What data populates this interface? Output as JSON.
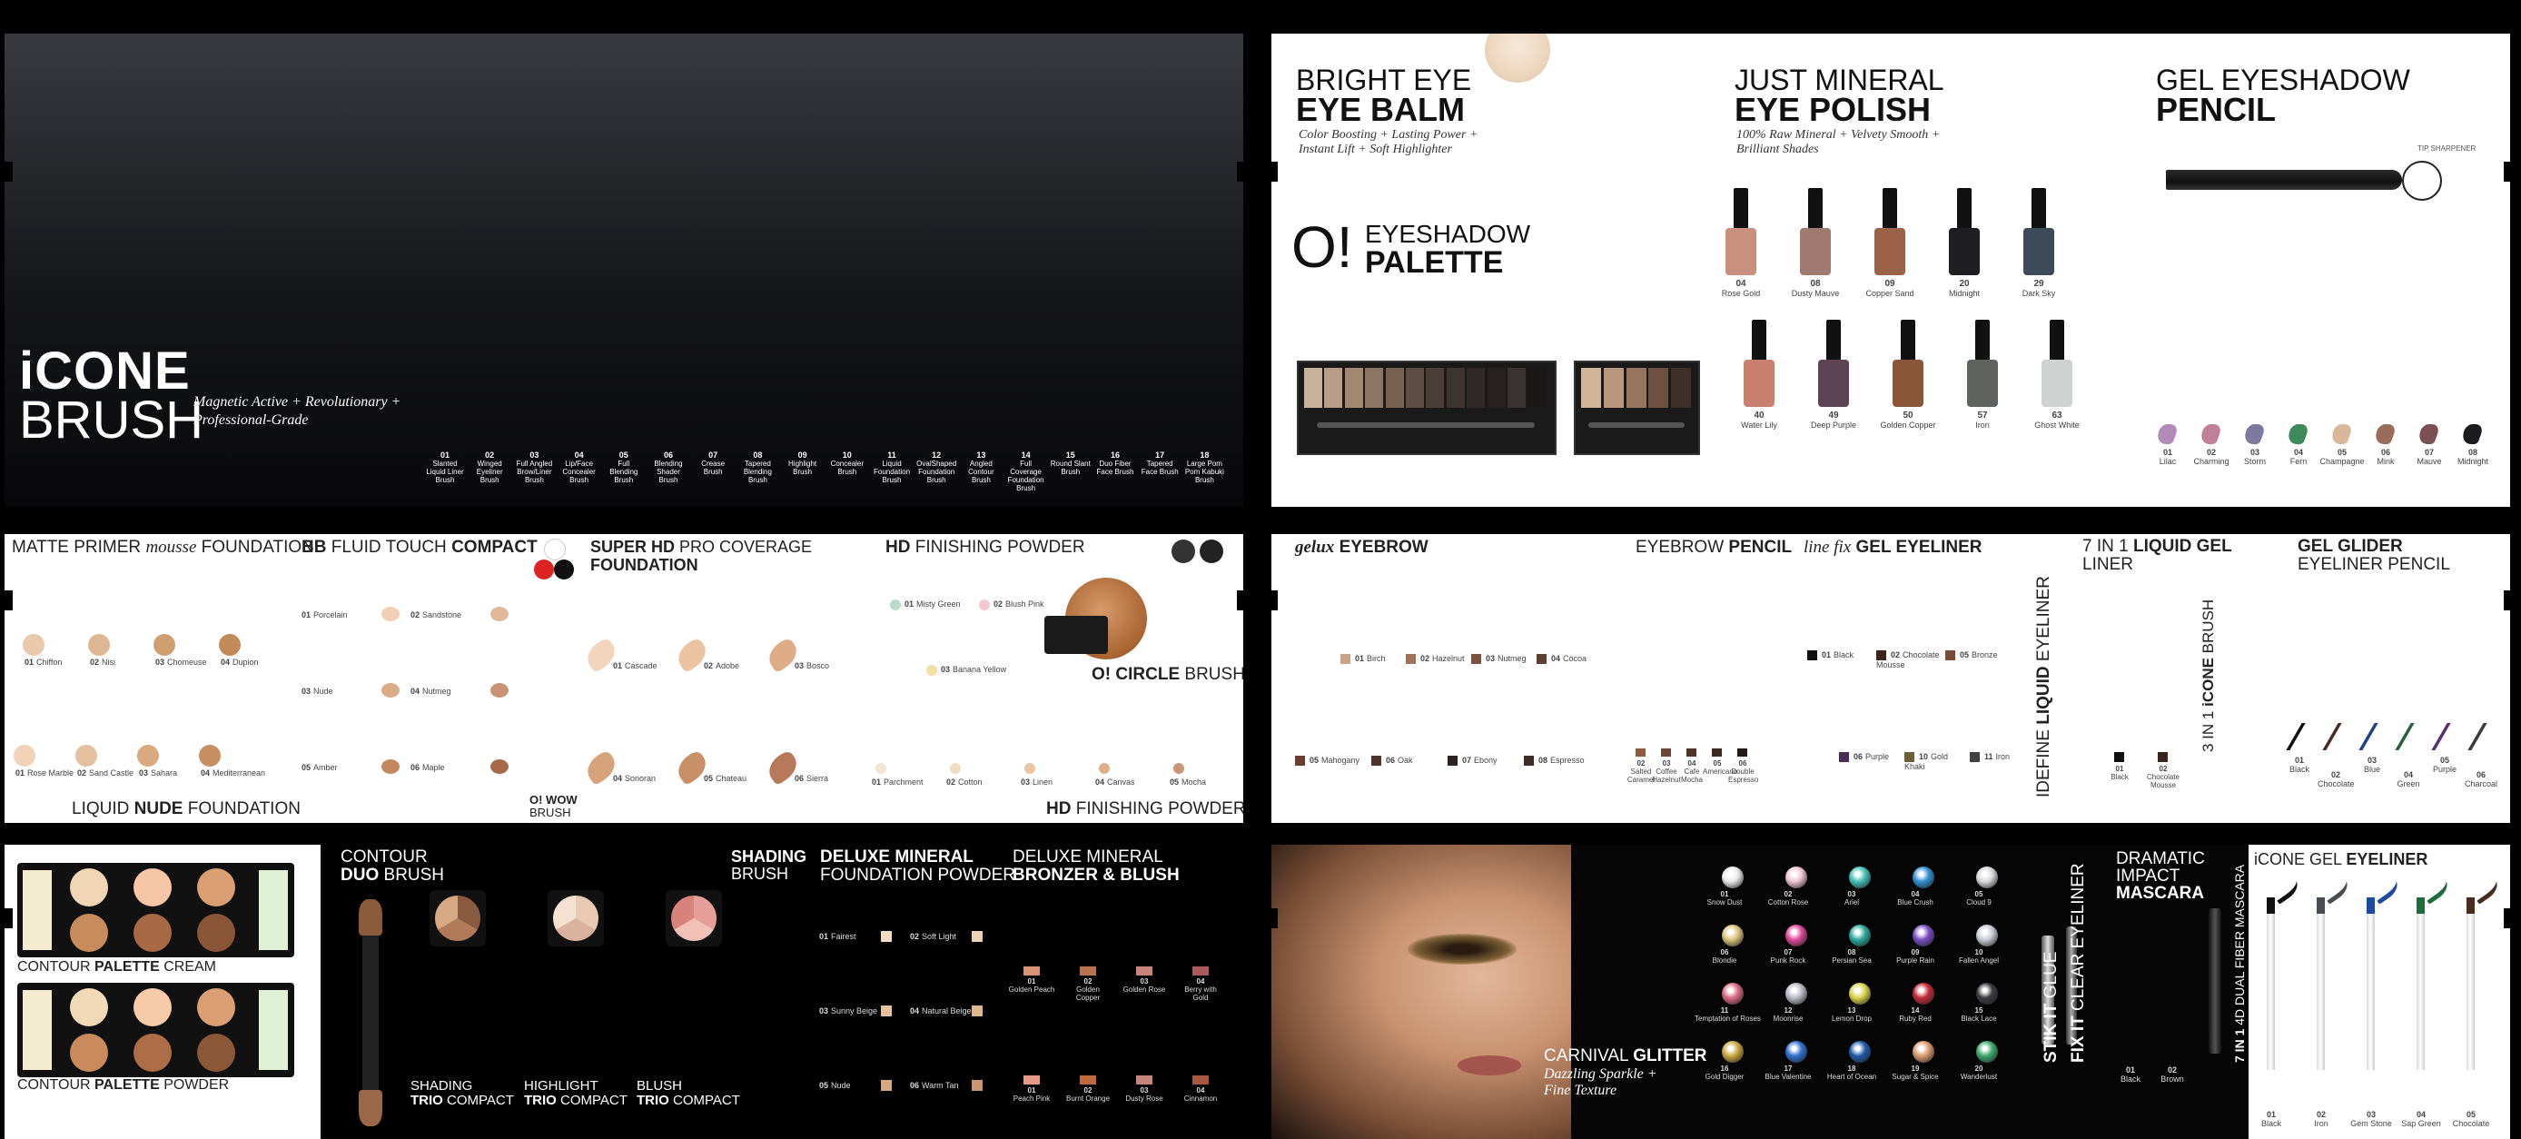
{
  "panel1": {
    "brand_line1": "iCONE",
    "brand_line2": "BRUSH",
    "tagline1": "Magnetic Active + Revolutionary +",
    "tagline2": "Professional-Grade",
    "brushes": [
      {
        "num": "01",
        "name": "Slanted Liquid Liner Brush"
      },
      {
        "num": "02",
        "name": "Winged Eyeliner Brush"
      },
      {
        "num": "03",
        "name": "Full Angled Brow/Liner Brush"
      },
      {
        "num": "04",
        "name": "Lip/Face Concealer Brush"
      },
      {
        "num": "05",
        "name": "Full Blending Brush"
      },
      {
        "num": "06",
        "name": "Blending Shader Brush"
      },
      {
        "num": "07",
        "name": "Crease Brush"
      },
      {
        "num": "08",
        "name": "Tapered Blending Brush"
      },
      {
        "num": "09",
        "name": "Highlight Brush"
      },
      {
        "num": "10",
        "name": "Concealer Brush"
      },
      {
        "num": "11",
        "name": "Liquid Foundation Brush"
      },
      {
        "num": "12",
        "name": "OvalShaped Foundation Brush"
      },
      {
        "num": "13",
        "name": "Angled Contour Brush"
      },
      {
        "num": "14",
        "name": "Full Coverage Foundation Brush"
      },
      {
        "num": "15",
        "name": "Round Slant Brush"
      },
      {
        "num": "16",
        "name": "Duo Fiber Face Brush"
      },
      {
        "num": "17",
        "name": "Tapered Face Brush"
      },
      {
        "num": "18",
        "name": "Large Pom Pom Kabuki Brush"
      }
    ]
  },
  "panel2": {
    "balm_l1": "BRIGHT EYE",
    "balm_l2": "EYE BALM",
    "balm_sub1": "Color Boosting + Lasting Power +",
    "balm_sub2": "Instant Lift + Soft Highlighter",
    "palette_o": "O!",
    "palette_l1": "EYESHADOW",
    "palette_l2": "PALETTE",
    "mineral_l1": "JUST MINERAL",
    "mineral_l2": "EYE POLISH",
    "mineral_sub1": "100% Raw Mineral + Velvety Smooth +",
    "mineral_sub2": "Brilliant Shades",
    "gel_l1": "GEL EYESHADOW",
    "gel_l2": "PENCIL",
    "tip": "TIP SHARPENER",
    "polish_top": [
      {
        "num": "04",
        "name": "Rose Gold",
        "color": "#c98f7f"
      },
      {
        "num": "08",
        "name": "Dusty Mauve",
        "color": "#a07a70"
      },
      {
        "num": "09",
        "name": "Copper Sand",
        "color": "#9c6248"
      },
      {
        "num": "20",
        "name": "Midnight",
        "color": "#1d1d22"
      },
      {
        "num": "29",
        "name": "Dark Sky",
        "color": "#3d4a57"
      }
    ],
    "polish_bottom": [
      {
        "num": "40",
        "name": "Water Lily",
        "color": "#c9806e"
      },
      {
        "num": "49",
        "name": "Deep Purple",
        "color": "#5c4452"
      },
      {
        "num": "50",
        "name": "Golden Copper",
        "color": "#8b5638"
      },
      {
        "num": "57",
        "name": "Iron",
        "color": "#5f6360"
      },
      {
        "num": "63",
        "name": "Ghost White",
        "color": "#cfd2d1"
      }
    ],
    "pencils": [
      {
        "num": "01",
        "name": "Lilac",
        "color": "#b48ab8"
      },
      {
        "num": "02",
        "name": "Charming",
        "color": "#c17f98"
      },
      {
        "num": "03",
        "name": "Storm",
        "color": "#7d7aa0"
      },
      {
        "num": "04",
        "name": "Fern",
        "color": "#3f8a5b"
      },
      {
        "num": "05",
        "name": "Champagne",
        "color": "#d9b79b"
      },
      {
        "num": "06",
        "name": "Mink",
        "color": "#9a6c5a"
      },
      {
        "num": "07",
        "name": "Mauve",
        "color": "#7c4f52"
      },
      {
        "num": "08",
        "name": "Midnight",
        "color": "#1a1a1f"
      }
    ]
  },
  "panel3": {
    "matte_a": "MATTE PRIMER",
    "matte_b": "mousse",
    "matte_c": "FOUNDATION",
    "bb_a": "BB",
    "bb_b": "FLUID TOUCH",
    "bb_c": "COMPACT",
    "shd_a": "SUPER HD",
    "shd_b": "PRO COVERAGE",
    "shd_c": "FOUNDATION",
    "hdp_a": "HD",
    "hdp_b": "FINISHING POWDER",
    "ocircle_a": "O!",
    "ocircle_b": "CIRCLE",
    "ocircle_c": "BRUSH",
    "liquid_a": "LIQUID",
    "liquid_b": "NUDE",
    "liquid_c": "FOUNDATION",
    "owow_a": "O! WOW",
    "owow_b": "BRUSH",
    "hdp2_a": "HD",
    "hdp2_b": "FINISHING POWDER",
    "matte_shades": [
      {
        "num": "01",
        "name": "Chiffon",
        "color": "#e8c9ab"
      },
      {
        "num": "02",
        "name": "Nisi",
        "color": "#ddb893"
      },
      {
        "num": "03",
        "name": "Chomeuse",
        "color": "#cf9f72"
      },
      {
        "num": "04",
        "name": "Dupion",
        "color": "#c18a58"
      }
    ],
    "liquid_shades": [
      {
        "num": "01",
        "name": "Rose Marble",
        "color": "#f0d3b9"
      },
      {
        "num": "02",
        "name": "Sand Castle",
        "color": "#e4c19e"
      },
      {
        "num": "03",
        "name": "Sahara",
        "color": "#d9a97f"
      },
      {
        "num": "04",
        "name": "Mediterranean",
        "color": "#c88f63"
      }
    ],
    "bb_shades": [
      {
        "num": "01",
        "name": "Porcelain",
        "color": "#f0cfb5"
      },
      {
        "num": "02",
        "name": "Sandstone",
        "color": "#e2b896"
      },
      {
        "num": "03",
        "name": "Nude",
        "color": "#d9ab88"
      },
      {
        "num": "04",
        "name": "Nutmeg",
        "color": "#c99473"
      },
      {
        "num": "05",
        "name": "Amber",
        "color": "#c4875e"
      },
      {
        "num": "06",
        "name": "Maple",
        "color": "#a96846"
      }
    ],
    "shd_shades": [
      {
        "num": "01",
        "name": "Cascade",
        "color": "#f3d5bd"
      },
      {
        "num": "02",
        "name": "Adobe",
        "color": "#ecc4a2"
      },
      {
        "num": "03",
        "name": "Bosco",
        "color": "#deac86"
      },
      {
        "num": "04",
        "name": "Sonoran",
        "color": "#d7a37b"
      },
      {
        "num": "05",
        "name": "Chateau",
        "color": "#c99068"
      },
      {
        "num": "06",
        "name": "Sierra",
        "color": "#b8795a"
      }
    ],
    "hdp_top": [
      {
        "num": "01",
        "name": "Misty Green",
        "color": "#b9dcc9"
      },
      {
        "num": "02",
        "name": "Blush Pink",
        "color": "#f3c8d0"
      },
      {
        "num": "03",
        "name": "Banana Yellow",
        "color": "#f3dfa6"
      }
    ],
    "hdp_bottom": [
      {
        "num": "01",
        "name": "Parchment",
        "color": "#f3e6d2"
      },
      {
        "num": "02",
        "name": "Cotton",
        "color": "#f2dcc0"
      },
      {
        "num": "03",
        "name": "Linen",
        "color": "#e9c7a2"
      },
      {
        "num": "04",
        "name": "Canvas",
        "color": "#dcb18a"
      },
      {
        "num": "05",
        "name": "Mocha",
        "color": "#c89672"
      }
    ]
  },
  "panel4": {
    "gelux_a": "gelux",
    "gelux_b": "EYEBROW",
    "pencil_a": "EYEBROW",
    "pencil_b": "PENCIL",
    "linefix_a": "line fix",
    "linefix_b": "GEL EYELINER",
    "idefine_a": "IDEFINE",
    "idefine_b": "LIQUID",
    "idefine_c": "EYELINER",
    "seven_a": "7 IN 1",
    "seven_b": "LIQUID GEL",
    "seven_c": "LINER",
    "icone_a": "3 IN 1",
    "icone_b": "iCONE",
    "icone_c": "BRUSH",
    "glider_a": "GEL GLIDER",
    "glider_b": "EYELINER PENCIL",
    "gelux_top": [
      {
        "num": "01",
        "name": "Birch",
        "color": "#c9a288"
      },
      {
        "num": "02",
        "name": "Hazelnut",
        "color": "#9f7257"
      },
      {
        "num": "03",
        "name": "Nutmeg",
        "color": "#7a5240"
      },
      {
        "num": "04",
        "name": "Cocoa",
        "color": "#5c3e33"
      }
    ],
    "gelux_bottom": [
      {
        "num": "05",
        "name": "Mahogany",
        "color": "#6b3d2f"
      },
      {
        "num": "06",
        "name": "Oak",
        "color": "#4e3329"
      },
      {
        "num": "07",
        "name": "Ebony",
        "color": "#2c221f"
      },
      {
        "num": "08",
        "name": "Espresso",
        "color": "#3c2a24"
      }
    ],
    "pencil_shades": [
      {
        "num": "02",
        "name": "Salted Caramel",
        "color": "#8d5b3d"
      },
      {
        "num": "03",
        "name": "Coffee Hazelnut",
        "color": "#6e4432"
      },
      {
        "num": "04",
        "name": "Cafe Mocha",
        "color": "#4f3428"
      },
      {
        "num": "05",
        "name": "Americano",
        "color": "#3c2a22"
      },
      {
        "num": "06",
        "name": "Double Espresso",
        "color": "#241a16"
      }
    ],
    "linefix_top": [
      {
        "num": "01",
        "name": "Black",
        "color": "#111111"
      },
      {
        "num": "02",
        "name": "Chocolate Mousse",
        "color": "#3a241b"
      },
      {
        "num": "05",
        "name": "Bronze",
        "color": "#7a4c35"
      }
    ],
    "linefix_bottom": [
      {
        "num": "06",
        "name": "Purple",
        "color": "#4a2d55"
      },
      {
        "num": "10",
        "name": "Gold Khaki",
        "color": "#6b6134"
      },
      {
        "num": "11",
        "name": "Iron",
        "color": "#3f4146"
      }
    ],
    "seven_shades": [
      {
        "num": "01",
        "name": "Black",
        "color": "#111111"
      },
      {
        "num": "02",
        "name": "Chocolate Mousse",
        "color": "#3a241b"
      }
    ],
    "glider_shades": [
      {
        "num": "01",
        "name": "Black",
        "color": "#111111"
      },
      {
        "num": "02",
        "name": "Chocolate",
        "color": "#4a2b1f"
      },
      {
        "num": "03",
        "name": "Blue",
        "color": "#1f3f8a"
      },
      {
        "num": "04",
        "name": "Green",
        "color": "#25603f"
      },
      {
        "num": "05",
        "name": "Purple",
        "color": "#5a2f6d"
      },
      {
        "num": "06",
        "name": "Charcoal",
        "color": "#3a3a3a"
      }
    ]
  },
  "panel5": {
    "contour_cream_a": "CONTOUR",
    "contour_cream_b": "PALETTE",
    "contour_cream_c": "CREAM",
    "contour_powder_a": "CONTOUR",
    "contour_powder_b": "PALETTE",
    "contour_powder_c": "POWDER",
    "duo_a": "CONTOUR",
    "duo_b": "DUO",
    "duo_c": "BRUSH",
    "shading_a": "SHADING",
    "shading_b": "BRUSH",
    "trio1_a": "SHADING",
    "trio1_b": "TRIO",
    "trio1_c": "COMPACT",
    "trio2_a": "HIGHLIGHT",
    "trio2_b": "TRIO",
    "trio2_c": "COMPACT",
    "trio3_a": "BLUSH",
    "trio3_b": "TRIO",
    "trio3_c": "COMPACT",
    "deluxe1_a": "DELUXE",
    "deluxe1_b": "MINERAL",
    "deluxe1_c": "FOUNDATION POWDER",
    "deluxe2_a": "DELUXE MINERAL",
    "deluxe2_b": "BRONZER & BLUSH",
    "foundation": [
      {
        "num": "01",
        "name": "Fairest",
        "color": "#f3dcc5"
      },
      {
        "num": "02",
        "name": "Soft Light",
        "color": "#efd2b6"
      },
      {
        "num": "03",
        "name": "Sunny Beige",
        "color": "#e6c29f"
      },
      {
        "num": "04",
        "name": "Natural Beige",
        "color": "#deb58f"
      },
      {
        "num": "05",
        "name": "Nude",
        "color": "#d6a882"
      },
      {
        "num": "06",
        "name": "Warm Tan",
        "color": "#c99672"
      }
    ],
    "bronzer_top": [
      {
        "num": "01",
        "name": "Golden Peach",
        "color": "#d89274"
      },
      {
        "num": "02",
        "name": "Golden Copper",
        "color": "#b8734f"
      },
      {
        "num": "03",
        "name": "Golden Rose",
        "color": "#c9847a"
      },
      {
        "num": "04",
        "name": "Berry with Gold",
        "color": "#a85a5d"
      }
    ],
    "bronzer_bottom": [
      {
        "num": "01",
        "name": "Peach Pink",
        "color": "#e79a8a"
      },
      {
        "num": "02",
        "name": "Burnt Orange",
        "color": "#c0683e"
      },
      {
        "num": "03",
        "name": "Dusty Rose",
        "color": "#c68579"
      },
      {
        "num": "04",
        "name": "Cinnamon",
        "color": "#a7583e"
      }
    ]
  },
  "panel6": {
    "carnival_a": "CARNIVAL",
    "carnival_b": "GLITTER",
    "carnival_sub1": "Dazzling Sparkle +",
    "carnival_sub2": "Fine Texture",
    "stikit_a": "STIK IT",
    "stikit_b": "GLUE",
    "fixit_a": "FIX IT",
    "fixit_b": "CLEAR EYELINER",
    "mascara_a": "DRAMATIC",
    "mascara_b": "IMPACT",
    "mascara_c": "MASCARA",
    "seven_mascara_a": "7 IN 1",
    "seven_mascara_b": "4D DUAL FIBER MASCARA",
    "icone_gel_a": "iCONE GEL",
    "icone_gel_b": "EYELINER",
    "glitter": [
      {
        "num": "01",
        "name": "Snow Dust",
        "color": "#e9e9ea"
      },
      {
        "num": "02",
        "name": "Cotton Rose",
        "color": "#f0c3d2"
      },
      {
        "num": "03",
        "name": "Ariel",
        "color": "#41c0b4"
      },
      {
        "num": "04",
        "name": "Blue Crush",
        "color": "#2f8fd0"
      },
      {
        "num": "05",
        "name": "Cloud 9",
        "color": "#d7d7dc"
      },
      {
        "num": "06",
        "name": "Blondie",
        "color": "#d9c37a"
      },
      {
        "num": "07",
        "name": "Punk Rock",
        "color": "#e0479a"
      },
      {
        "num": "08",
        "name": "Persian Sea",
        "color": "#2aa79a"
      },
      {
        "num": "09",
        "name": "Purple Rain",
        "color": "#7a4cc2"
      },
      {
        "num": "10",
        "name": "Fallen Angel",
        "color": "#c8cbd2"
      },
      {
        "num": "11",
        "name": "Temptation of Roses",
        "color": "#d86a82"
      },
      {
        "num": "12",
        "name": "Moonrise",
        "color": "#b9b9c5"
      },
      {
        "num": "13",
        "name": "Lemon Drop",
        "color": "#d8d24a"
      },
      {
        "num": "14",
        "name": "Ruby Red",
        "color": "#c42a36"
      },
      {
        "num": "15",
        "name": "Black Lace",
        "color": "#3a3a40"
      },
      {
        "num": "16",
        "name": "Gold Digger",
        "color": "#c9a53c"
      },
      {
        "num": "17",
        "name": "Blue Valentine",
        "color": "#2f6fd0"
      },
      {
        "num": "18",
        "name": "Heart of Ocean",
        "color": "#1f5aa8"
      },
      {
        "num": "19",
        "name": "Sugar & Spice",
        "color": "#d89a6e"
      },
      {
        "num": "20",
        "name": "Wanderlust",
        "color": "#3aa86a"
      }
    ],
    "mascara_shades": [
      {
        "num": "01",
        "name": "Black"
      },
      {
        "num": "02",
        "name": "Brown"
      }
    ],
    "gel_liners": [
      {
        "num": "01",
        "name": "Black",
        "color": "#111111"
      },
      {
        "num": "02",
        "name": "Iron",
        "color": "#4a4d52"
      },
      {
        "num": "03",
        "name": "Gem Stone",
        "color": "#1c4aa0"
      },
      {
        "num": "04",
        "name": "Sap Green",
        "color": "#1f6b3a"
      },
      {
        "num": "05",
        "name": "Chocolate",
        "color": "#4a2b1f"
      }
    ]
  }
}
